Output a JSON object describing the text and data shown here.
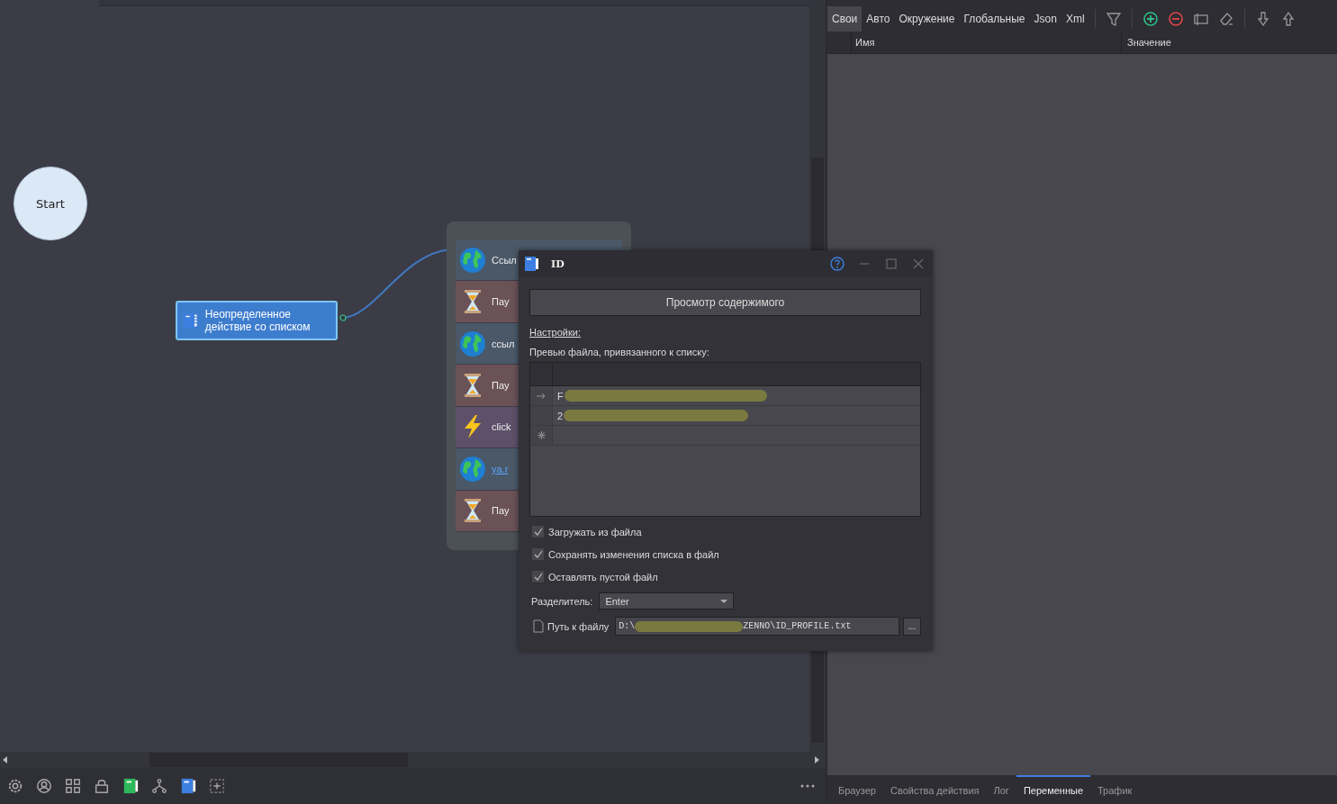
{
  "canvas": {
    "start_node": {
      "label": "Start"
    },
    "list_node": {
      "label": "Неопределенное действие со списком",
      "selected": true
    },
    "group_items": [
      {
        "kind": "web",
        "label": "Ссыл"
      },
      {
        "kind": "pause",
        "label": "Пау"
      },
      {
        "kind": "web",
        "label": "ссыл"
      },
      {
        "kind": "pause",
        "label": "Пау"
      },
      {
        "kind": "action",
        "label": "click"
      },
      {
        "kind": "link",
        "label": "ya.r"
      },
      {
        "kind": "pause",
        "label": "Пау"
      }
    ]
  },
  "dialog": {
    "title": "ID",
    "view_button": "Просмотр содержимого",
    "settings_link": "Настройки:",
    "preview_label": "Превью файла, привязанного к списку:",
    "preview_rows": [
      {
        "kind": "current",
        "text": "F"
      },
      {
        "kind": "row",
        "text": "2"
      },
      {
        "kind": "new"
      }
    ],
    "checkboxes": [
      {
        "label": "Загружать из файла",
        "checked": true
      },
      {
        "label": "Сохранять изменения списка в файл",
        "checked": true
      },
      {
        "label": "Оставлять пустой файл",
        "checked": true
      }
    ],
    "separator_label": "Разделитель:",
    "separator_value": "Enter",
    "path_label": "Путь к файлу",
    "path_start": "D:\\",
    "path_end": "ZENNO\\ID_PROFILE.txt",
    "browse_button": "..."
  },
  "variables_panel": {
    "tabs": [
      {
        "label": "Свои",
        "selected": true
      },
      {
        "label": "Авто",
        "selected": false
      },
      {
        "label": "Окружение",
        "selected": false
      },
      {
        "label": "Глобальные",
        "selected": false
      },
      {
        "label": "Json",
        "selected": false
      },
      {
        "label": "Xml",
        "selected": false
      }
    ],
    "columns": [
      "Имя",
      "Значение"
    ]
  },
  "bottom_tabs": [
    {
      "label": "Браузер",
      "selected": false
    },
    {
      "label": "Свойства действия",
      "selected": false
    },
    {
      "label": "Лог",
      "selected": false
    },
    {
      "label": "Переменные",
      "selected": true
    },
    {
      "label": "Трафик",
      "selected": false
    }
  ]
}
